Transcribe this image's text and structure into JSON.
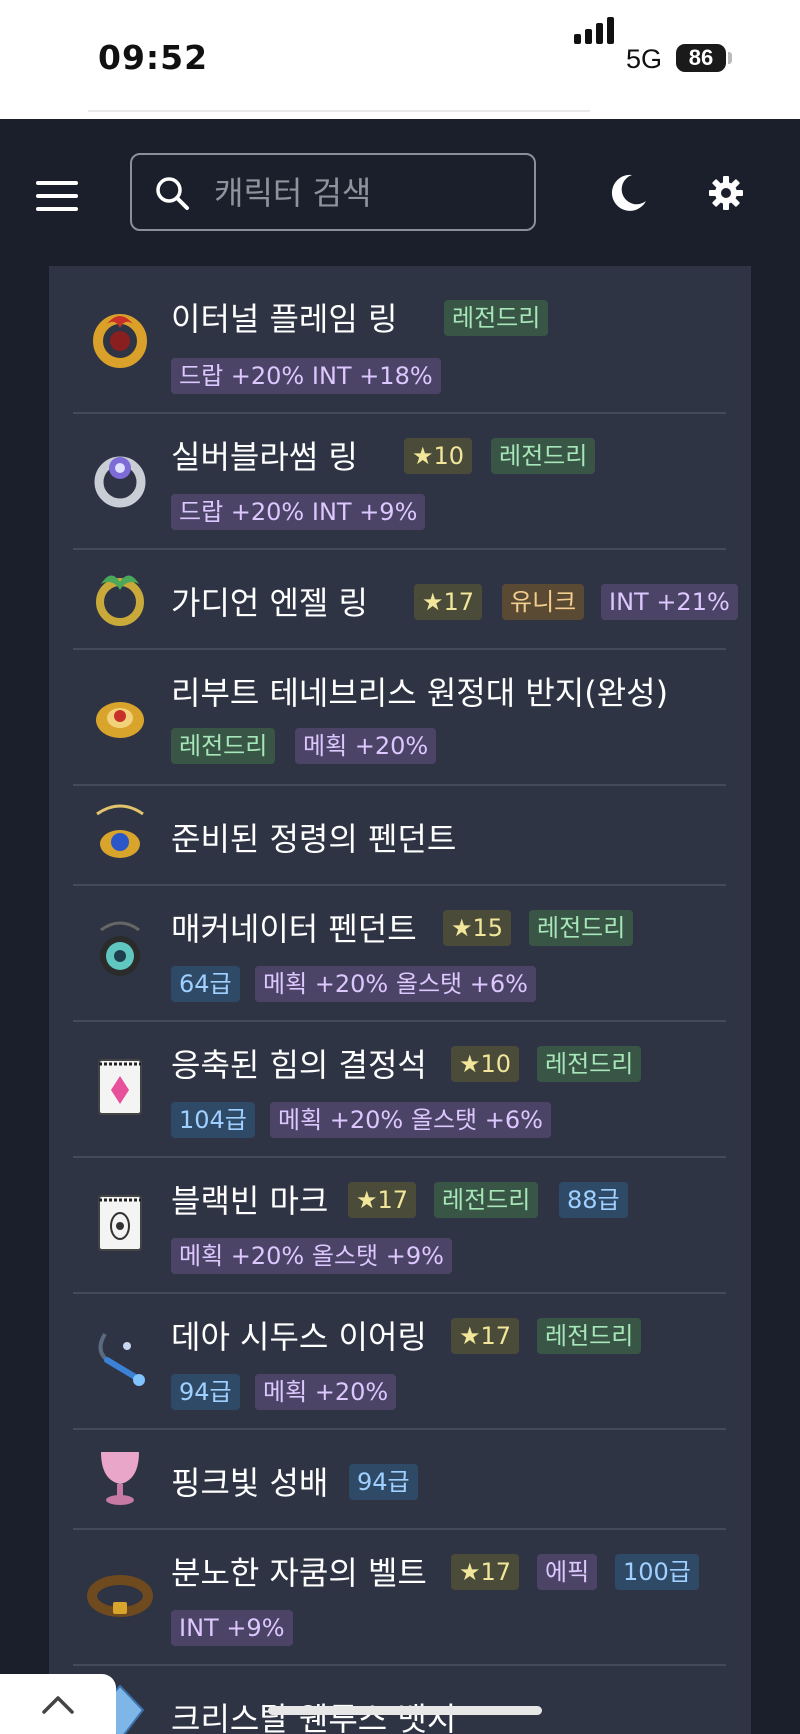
{
  "status_bar": {
    "time": "09:52",
    "network": "5G",
    "battery": "86"
  },
  "header": {
    "search_placeholder": "캐릭터 검색"
  },
  "items": [
    {
      "name": "이터널 플레임 링",
      "icon": "ring-flame-icon",
      "badges_line1": [
        "레전드리"
      ],
      "badges_line2": [
        "드랍 +20% INT +18%"
      ]
    },
    {
      "name": "실버블라썸 링",
      "icon": "ring-silver-icon",
      "star": "10",
      "badges_line1": [
        "레전드리"
      ],
      "badges_line2": [
        "드랍 +20% INT +9%"
      ]
    },
    {
      "name": "가디언 엔젤 링",
      "icon": "ring-guardian-icon",
      "star": "17",
      "unique": "유니크",
      "stat_inline": "INT +21%"
    },
    {
      "name": "리부트 테네브리스 원정대 반지(완성)",
      "icon": "ring-tenebris-icon",
      "badges_line2": [
        "레전드리",
        "메획 +20%"
      ]
    },
    {
      "name": "준비된 정령의 펜던트",
      "icon": "pendant-spirit-icon"
    },
    {
      "name": "매커네이터 펜던트",
      "icon": "pendant-mech-icon",
      "star": "15",
      "badges_line1": [
        "레전드리"
      ],
      "grade": "64급",
      "badges_line2": [
        "메획 +20% 올스탯 +6%"
      ]
    },
    {
      "name": "응축된 힘의 결정석",
      "icon": "crystal-icon",
      "star": "10",
      "badges_line1": [
        "레전드리"
      ],
      "grade": "104급",
      "badges_line2": [
        "메획 +20% 올스탯 +6%"
      ]
    },
    {
      "name": "블랙빈 마크",
      "icon": "mark-icon",
      "star": "17",
      "badges_line1": [
        "레전드리"
      ],
      "grade": "88급",
      "badges_line2": [
        "메획 +20% 올스탯 +9%"
      ]
    },
    {
      "name": "데아 시두스 이어링",
      "icon": "earring-icon",
      "star": "17",
      "badges_line1": [
        "레전드리"
      ],
      "grade": "94급",
      "badges_line2": [
        "메획 +20%"
      ]
    },
    {
      "name": "핑크빛 성배",
      "icon": "chalice-icon",
      "grade": "94급"
    },
    {
      "name": "분노한 자쿰의 벨트",
      "icon": "belt-icon",
      "star": "17",
      "epic": "에픽",
      "grade": "100급",
      "badges_line2": [
        "INT +9%"
      ]
    },
    {
      "name": "크리스탈 웬투스 뱃지",
      "icon": "badge-crystal-icon"
    }
  ],
  "colors": {
    "legendary": "#a7e6b8",
    "stat": "#dcc7ff",
    "star": "#f1e69a",
    "unique": "#f3ce8e",
    "grade": "#9fd0ff"
  }
}
